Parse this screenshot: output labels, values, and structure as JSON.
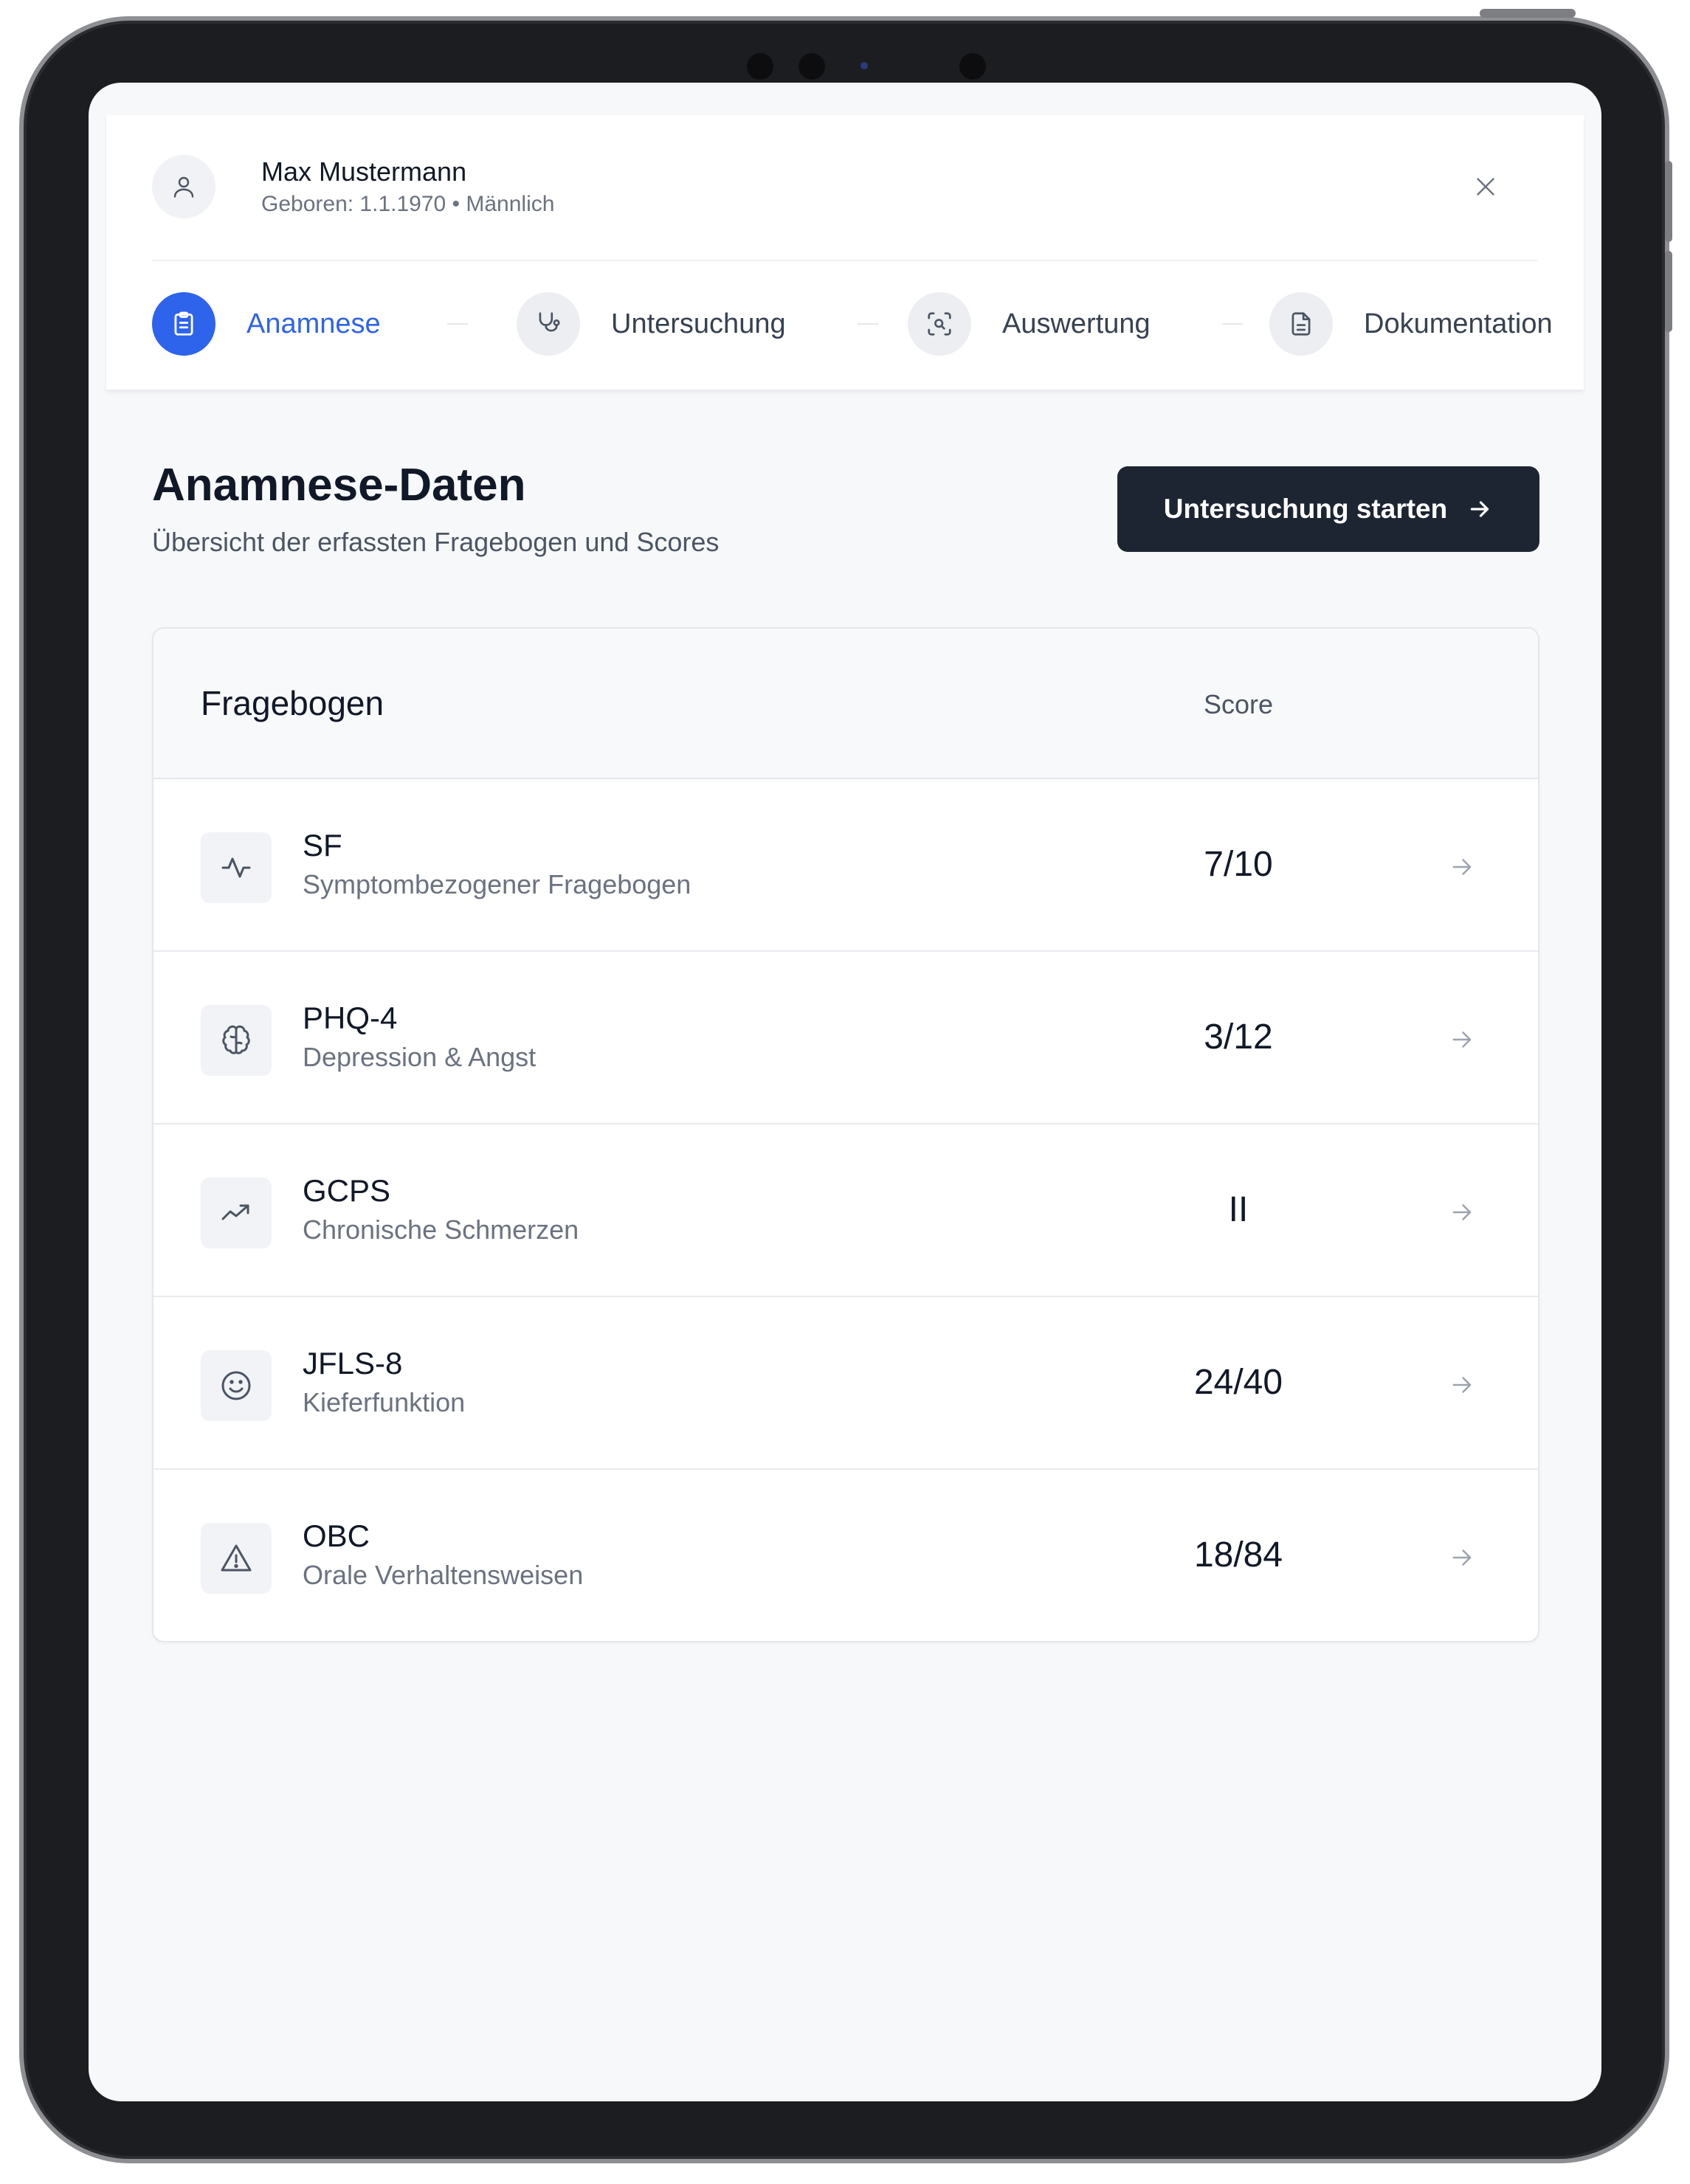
{
  "patient": {
    "name": "Max Mustermann",
    "meta": "Geboren: 1.1.1970 • Männlich"
  },
  "steps": [
    {
      "label": "Anamnese",
      "icon": "clipboard-icon",
      "active": true
    },
    {
      "label": "Untersuchung",
      "icon": "stethoscope-icon",
      "active": false
    },
    {
      "label": "Auswertung",
      "icon": "scan-search-icon",
      "active": false
    },
    {
      "label": "Dokumentation",
      "icon": "file-text-icon",
      "active": false
    }
  ],
  "page": {
    "title": "Anamnese-Daten",
    "subtitle": "Übersicht der erfassten Fragebogen und Scores",
    "start_button": "Untersuchung starten"
  },
  "table": {
    "col_name": "Fragebogen",
    "col_score": "Score",
    "rows": [
      {
        "code": "SF",
        "description": "Symptombezogener Fragebogen",
        "score": "7/10",
        "icon": "activity-icon"
      },
      {
        "code": "PHQ-4",
        "description": "Depression & Angst",
        "score": "3/12",
        "icon": "brain-icon"
      },
      {
        "code": "GCPS",
        "description": "Chronische Schmerzen",
        "score": "II",
        "icon": "trending-up-icon"
      },
      {
        "code": "JFLS-8",
        "description": "Kieferfunktion",
        "score": "24/40",
        "icon": "smile-icon"
      },
      {
        "code": "OBC",
        "description": "Orale Verhaltensweisen",
        "score": "18/84",
        "icon": "alert-triangle-icon"
      }
    ]
  },
  "colors": {
    "accent": "#2e63eb",
    "button_dark": "#1e2532",
    "text_primary": "#111827",
    "text_secondary": "#6b7280"
  }
}
